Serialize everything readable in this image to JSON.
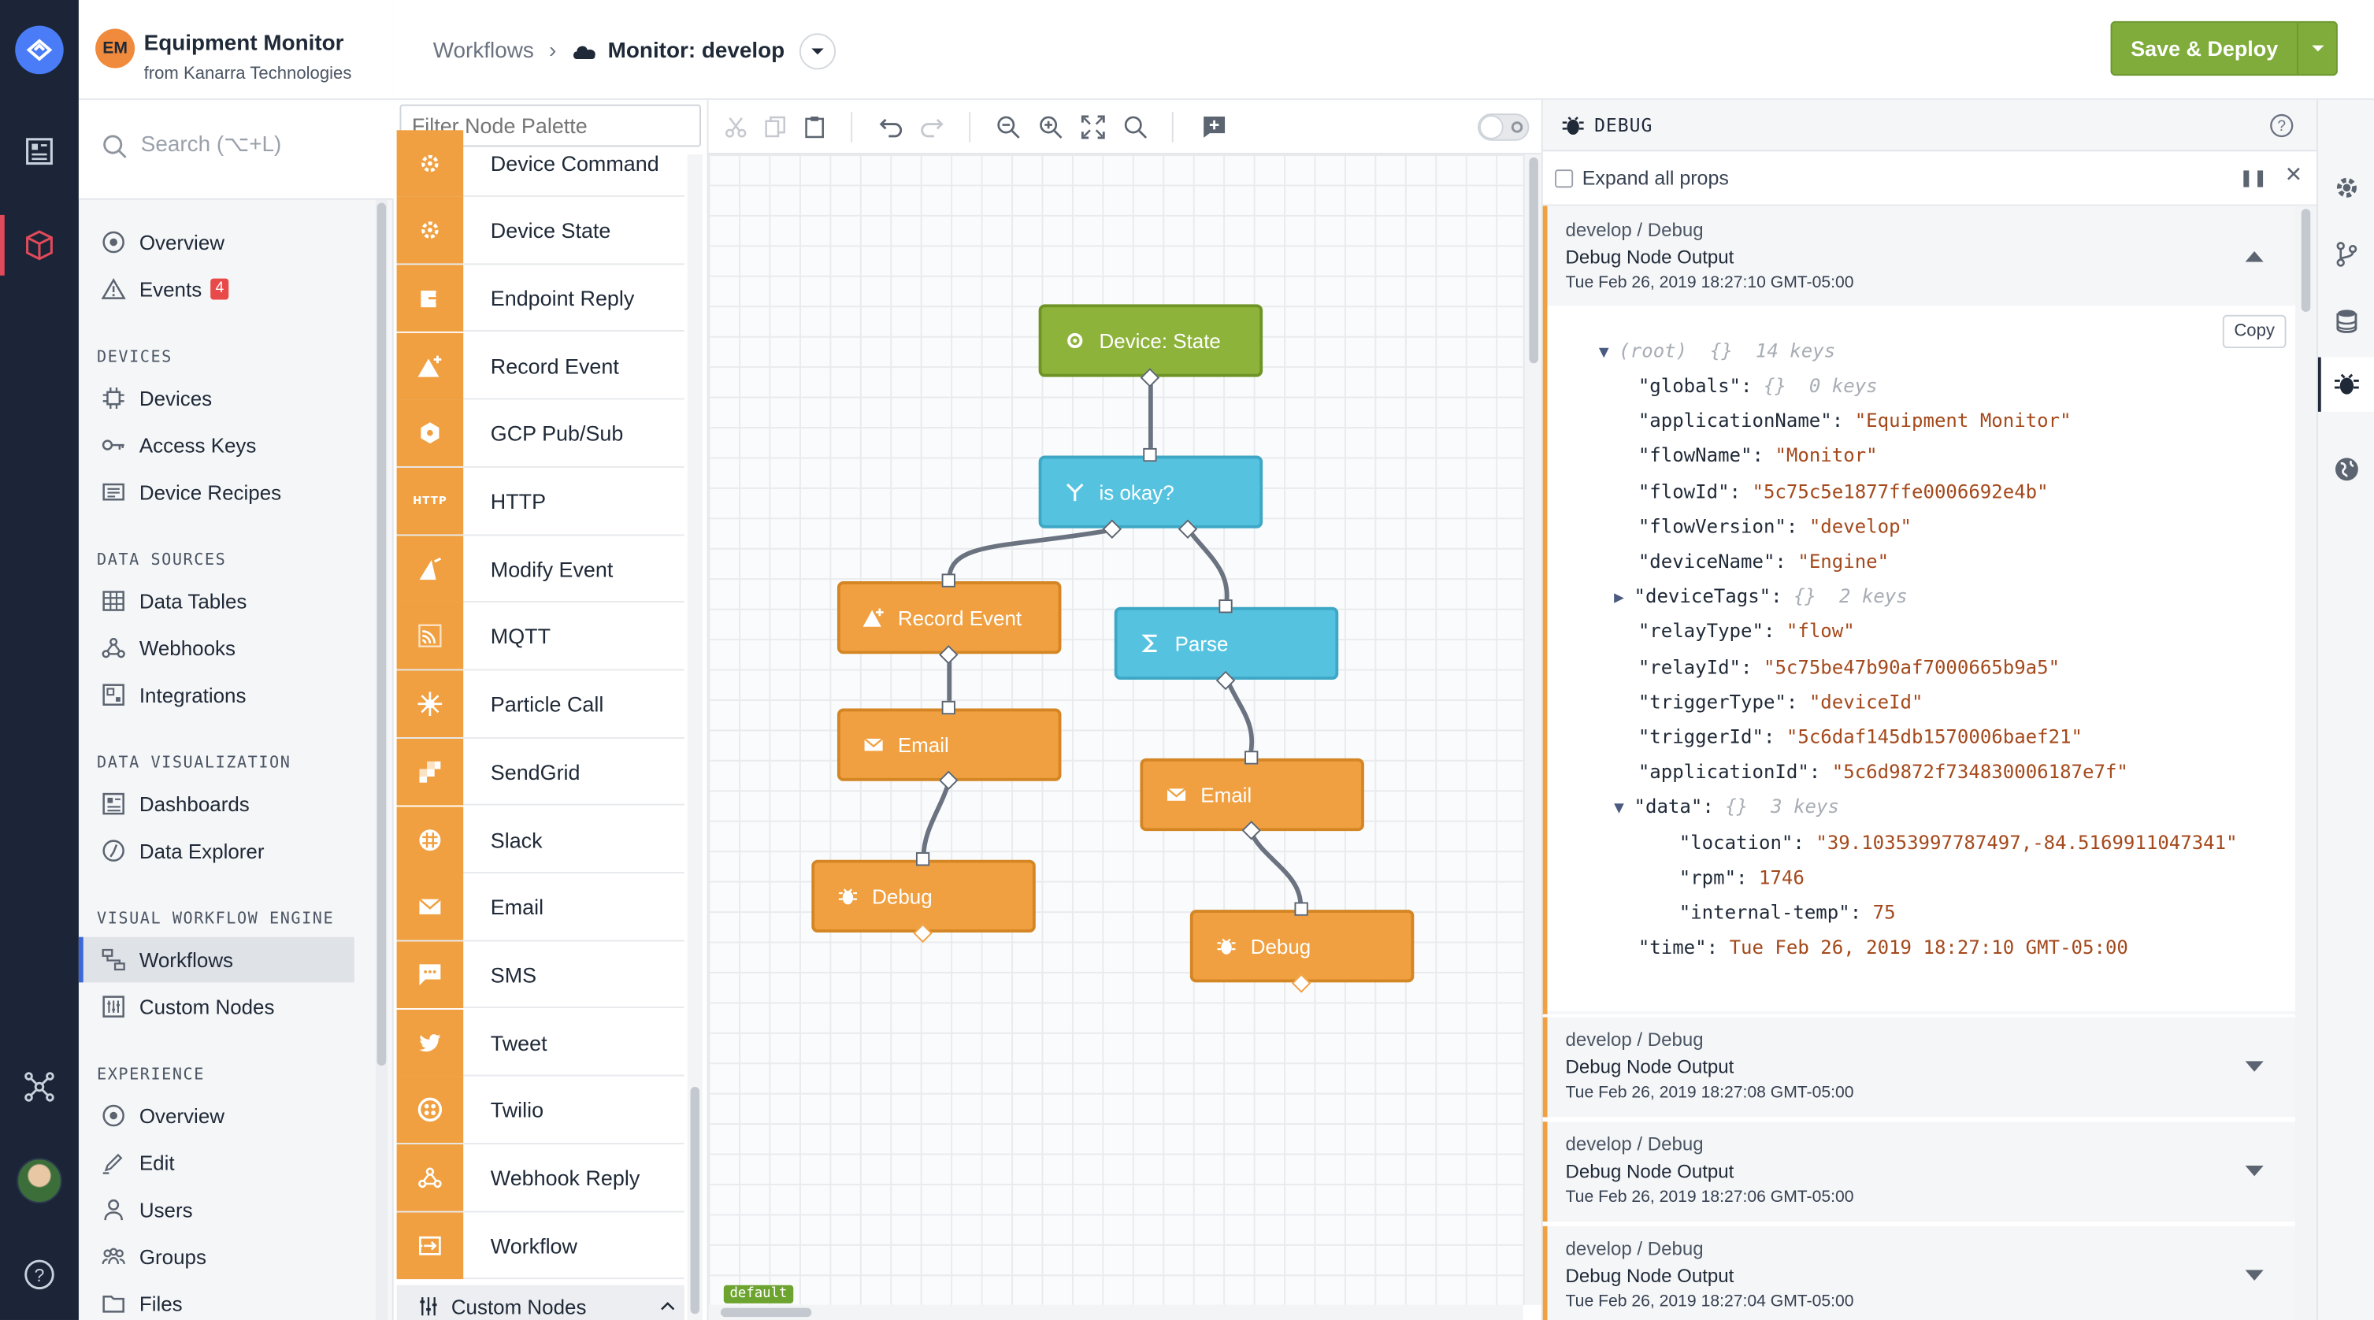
{
  "app": {
    "badge": "EM",
    "title": "Equipment Monitor",
    "subtitle": "from Kanarra Technologies"
  },
  "nav": {
    "search_placeholder": "Search (⌥+L)",
    "top_items": [
      {
        "label": "Overview",
        "icon": "overview-icon"
      },
      {
        "label": "Events",
        "icon": "warning-icon",
        "badge": "4"
      }
    ],
    "sections": [
      {
        "title": "DEVICES",
        "items": [
          {
            "label": "Devices",
            "icon": "chip-icon"
          },
          {
            "label": "Access Keys",
            "icon": "key-icon"
          },
          {
            "label": "Device Recipes",
            "icon": "recipe-icon"
          }
        ]
      },
      {
        "title": "DATA SOURCES",
        "items": [
          {
            "label": "Data Tables",
            "icon": "table-icon"
          },
          {
            "label": "Webhooks",
            "icon": "webhook-icon"
          },
          {
            "label": "Integrations",
            "icon": "integration-icon"
          }
        ]
      },
      {
        "title": "DATA VISUALIZATION",
        "items": [
          {
            "label": "Dashboards",
            "icon": "dashboard-icon"
          },
          {
            "label": "Data Explorer",
            "icon": "explorer-icon"
          }
        ]
      },
      {
        "title": "VISUAL WORKFLOW ENGINE",
        "items": [
          {
            "label": "Workflows",
            "icon": "workflow-icon",
            "active": true
          },
          {
            "label": "Custom Nodes",
            "icon": "custom-nodes-icon"
          }
        ]
      },
      {
        "title": "EXPERIENCE",
        "items": [
          {
            "label": "Overview",
            "icon": "overview-icon"
          },
          {
            "label": "Edit",
            "icon": "edit-icon"
          },
          {
            "label": "Users",
            "icon": "user-icon"
          },
          {
            "label": "Groups",
            "icon": "groups-icon"
          },
          {
            "label": "Files",
            "icon": "folder-icon"
          }
        ]
      }
    ]
  },
  "header": {
    "crumb_root": "Workflows",
    "crumb_sep": "›",
    "crumb_current": "Monitor: develop",
    "deploy_label": "Save & Deploy"
  },
  "palette": {
    "filter_placeholder": "Filter Node Palette",
    "items": [
      {
        "label": "Device Command",
        "icon": "gear-icon"
      },
      {
        "label": "Device State",
        "icon": "gear-icon"
      },
      {
        "label": "Endpoint Reply",
        "icon": "reply-icon"
      },
      {
        "label": "Record Event",
        "icon": "event-icon"
      },
      {
        "label": "GCP Pub/Sub",
        "icon": "hexagon-icon"
      },
      {
        "label": "HTTP",
        "icon": "http-icon"
      },
      {
        "label": "Modify Event",
        "icon": "modify-icon"
      },
      {
        "label": "MQTT",
        "icon": "mqtt-icon"
      },
      {
        "label": "Particle Call",
        "icon": "star-icon"
      },
      {
        "label": "SendGrid",
        "icon": "sendgrid-icon"
      },
      {
        "label": "Slack",
        "icon": "slack-icon"
      },
      {
        "label": "Email",
        "icon": "envelope-icon"
      },
      {
        "label": "SMS",
        "icon": "chat-icon"
      },
      {
        "label": "Tweet",
        "icon": "twitter-icon"
      },
      {
        "label": "Twilio",
        "icon": "twilio-icon"
      },
      {
        "label": "Webhook Reply",
        "icon": "webhook-icon"
      },
      {
        "label": "Workflow",
        "icon": "workflow-icon"
      }
    ],
    "custom_nodes_label": "Custom Nodes",
    "http_glyph": "HTTP"
  },
  "canvas": {
    "nodes": [
      {
        "id": "n1",
        "label": "Device: State",
        "color": "green"
      },
      {
        "id": "n2",
        "label": "is okay?",
        "color": "blue"
      },
      {
        "id": "n3",
        "label": "Record Event",
        "color": "orange"
      },
      {
        "id": "n4",
        "label": "Parse",
        "color": "blue"
      },
      {
        "id": "n5",
        "label": "Email",
        "color": "orange"
      },
      {
        "id": "n6",
        "label": "Email",
        "color": "orange"
      },
      {
        "id": "n7",
        "label": "Debug",
        "color": "orange"
      },
      {
        "id": "n8",
        "label": "Debug",
        "color": "orange"
      }
    ],
    "tag": "default"
  },
  "debug": {
    "title": "DEBUG",
    "expand_label": "Expand all props",
    "copy_label": "Copy",
    "messages": [
      {
        "source": "develop / Debug",
        "title": "Debug Node Output",
        "time": "Tue Feb 26, 2019 18:27:10 GMT-05:00",
        "expanded": true
      },
      {
        "source": "develop / Debug",
        "title": "Debug Node Output",
        "time": "Tue Feb 26, 2019 18:27:08 GMT-05:00"
      },
      {
        "source": "develop / Debug",
        "title": "Debug Node Output",
        "time": "Tue Feb 26, 2019 18:27:06 GMT-05:00"
      },
      {
        "source": "develop / Debug",
        "title": "Debug Node Output",
        "time": "Tue Feb 26, 2019 18:27:04 GMT-05:00"
      }
    ],
    "json": {
      "root": "(root)  {}  14 keys",
      "lines": [
        {
          "indent": 1,
          "key": "\"globals\":",
          "meta": "{}  0 keys"
        },
        {
          "indent": 1,
          "key": "\"applicationName\":",
          "val": "\"Equipment Monitor\""
        },
        {
          "indent": 1,
          "key": "\"flowName\":",
          "val": "\"Monitor\""
        },
        {
          "indent": 1,
          "key": "\"flowId\":",
          "val": "\"5c75c5e1877ffe0006692e4b\""
        },
        {
          "indent": 1,
          "key": "\"flowVersion\":",
          "val": "\"develop\""
        },
        {
          "indent": 1,
          "key": "\"deviceName\":",
          "val": "\"Engine\""
        },
        {
          "indent": 1,
          "key": "\"deviceTags\":",
          "meta": "{}  2 keys",
          "collapsed": true
        },
        {
          "indent": 1,
          "key": "\"relayType\":",
          "val": "\"flow\""
        },
        {
          "indent": 1,
          "key": "\"relayId\":",
          "val": "\"5c75be47b90af7000665b9a5\""
        },
        {
          "indent": 1,
          "key": "\"triggerType\":",
          "val": "\"deviceId\""
        },
        {
          "indent": 1,
          "key": "\"triggerId\":",
          "val": "\"5c6daf145db1570006baef21\""
        },
        {
          "indent": 1,
          "key": "\"applicationId\":",
          "val": "\"5c6d9872f734830006187e7f\""
        },
        {
          "indent": 1,
          "key": "\"data\":",
          "meta": "{}  3 keys",
          "expanded": true
        },
        {
          "indent": 2,
          "key": "\"location\":",
          "val": "\"39.10353997787497,-84.5169911047341\""
        },
        {
          "indent": 2,
          "key": "\"rpm\":",
          "val": "1746"
        },
        {
          "indent": 2,
          "key": "\"internal-temp\":",
          "val": "75"
        },
        {
          "indent": 1,
          "key": "\"time\":",
          "val": "Tue Feb 26, 2019 18:27:10 GMT-05:00"
        }
      ]
    }
  },
  "colors": {
    "accent_green": "#7fac3a",
    "node_green": "#8db33a",
    "node_blue": "#55c3e0",
    "node_orange": "#f0a040",
    "rail": "#1b2537"
  }
}
